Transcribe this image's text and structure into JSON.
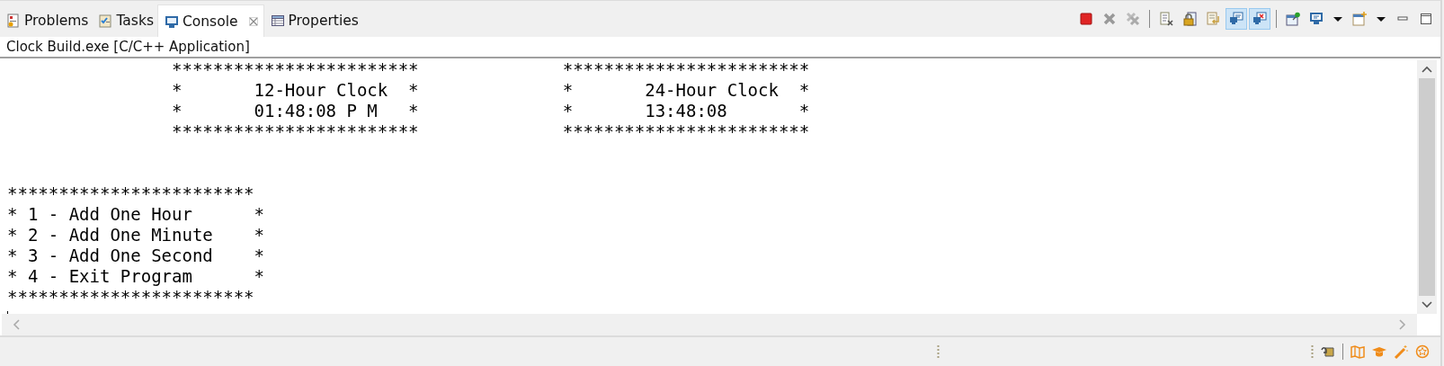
{
  "tabs": [
    {
      "label": "Problems",
      "kind": "problems",
      "selected": false
    },
    {
      "label": "Tasks",
      "kind": "tasks",
      "selected": false
    },
    {
      "label": "Console",
      "kind": "console",
      "selected": true
    },
    {
      "label": "Properties",
      "kind": "properties",
      "selected": false
    }
  ],
  "toolbar_groups": [
    {
      "buttons": [
        {
          "kind": "stop",
          "on": false
        },
        {
          "kind": "remove",
          "on": false
        },
        {
          "kind": "remove-all",
          "on": false
        }
      ]
    },
    {
      "buttons": [
        {
          "kind": "clear",
          "on": false
        },
        {
          "kind": "scroll-lock",
          "on": false
        },
        {
          "kind": "word-wrap",
          "on": false
        },
        {
          "kind": "stdout",
          "on": true
        },
        {
          "kind": "stderr",
          "on": true
        }
      ]
    },
    {
      "buttons": [
        {
          "kind": "pin",
          "on": false
        },
        {
          "kind": "display",
          "on": false
        },
        {
          "kind": "dropdown",
          "on": false
        },
        {
          "kind": "new-console",
          "on": false
        },
        {
          "kind": "dropdown",
          "on": false
        },
        {
          "kind": "minimize",
          "on": false
        },
        {
          "kind": "maximize",
          "on": false
        }
      ]
    }
  ],
  "console": {
    "title": "Clock Build.exe [C/C++ Application]",
    "clock_banner": [
      "                ************************              ************************",
      "                *       12-Hour Clock  *              *       24-Hour Clock  *",
      "                *       01:48:08 P M   *              *       13:48:08       *",
      "                ************************              ************************"
    ],
    "menu": [
      "************************",
      "* 1 - Add One Hour      *",
      "* 2 - Add One Minute    *",
      "* 3 - Add One Second    *",
      "* 4 - Exit Program      *",
      "************************"
    ]
  },
  "status_icons": [
    {
      "kind": "scroll"
    },
    {
      "kind": "map"
    },
    {
      "kind": "cap"
    },
    {
      "kind": "wand"
    },
    {
      "kind": "tips"
    }
  ]
}
